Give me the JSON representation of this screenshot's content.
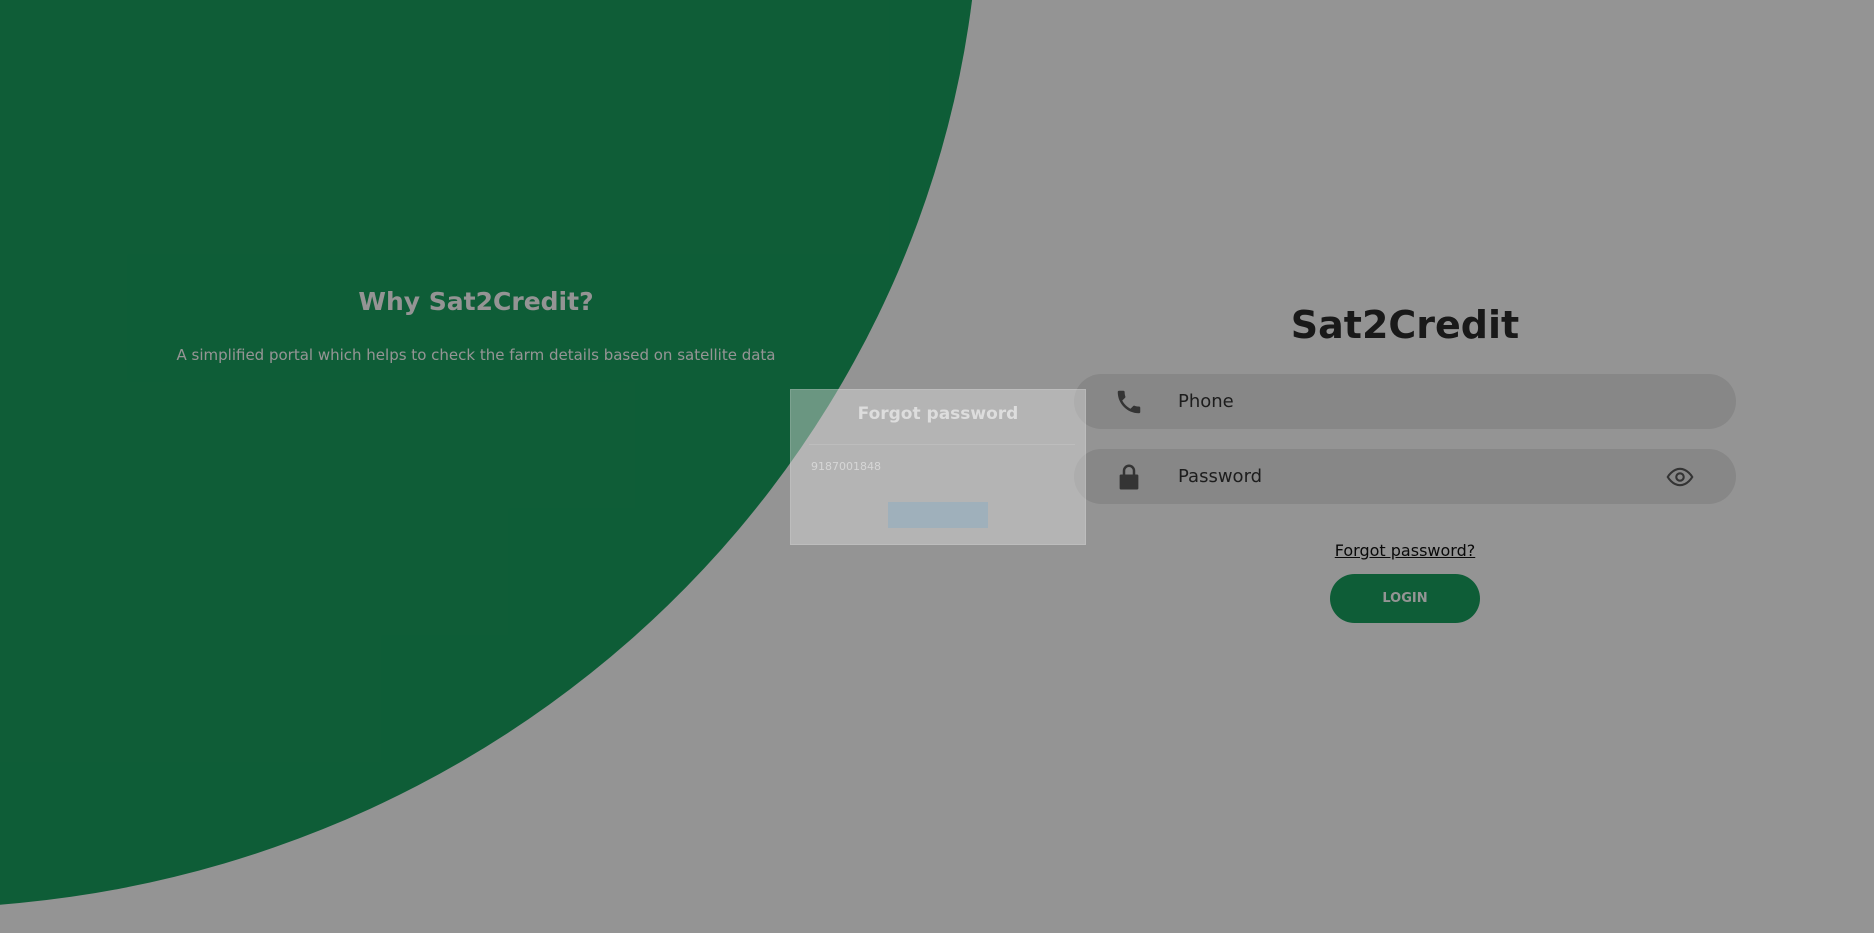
{
  "colors": {
    "brand_green": "#19a15f",
    "background": "#ffffff",
    "field_background": "#e8e8e8",
    "overlay": "rgba(0,0,0,0.42)"
  },
  "left_panel": {
    "title": "Why Sat2Credit?",
    "description": "A simplified portal which helps to check the farm details based on satellite data"
  },
  "login_form": {
    "brand_title": "Sat2Credit",
    "phone": {
      "placeholder": "Phone",
      "icon": "phone-icon"
    },
    "password": {
      "placeholder": "Password",
      "icon": "lock-icon",
      "toggle_icon": "eye-icon"
    },
    "forgot_password_link": "Forgot password?",
    "login_button": "LOGIN"
  },
  "forgot_password_modal": {
    "title": "Forgot password",
    "phone_value": "9187001848"
  }
}
